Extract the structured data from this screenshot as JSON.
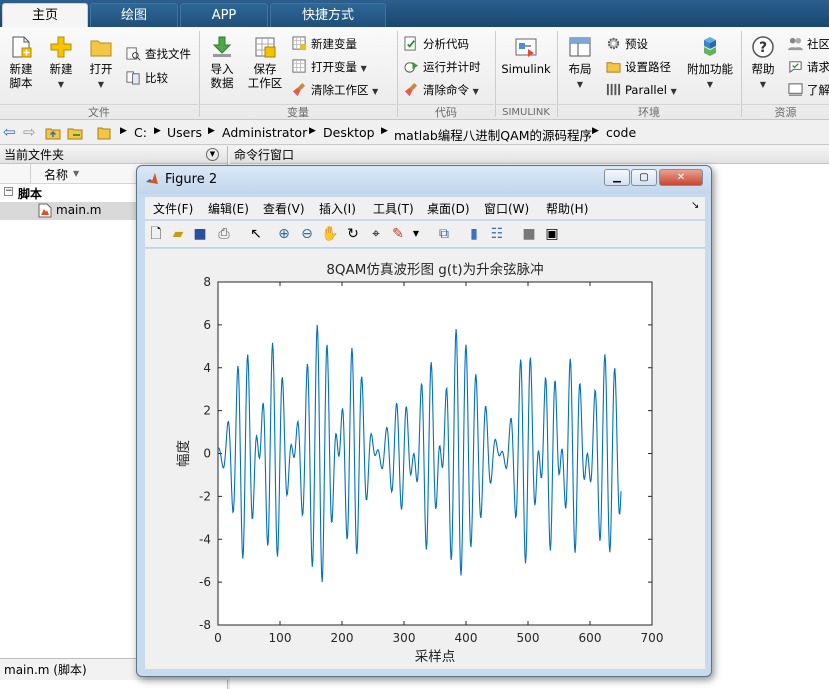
{
  "tabs": [
    "主页",
    "绘图",
    "APP",
    "快捷方式"
  ],
  "ribbon": {
    "file": {
      "new_script": "新建\n脚本",
      "new": "新建",
      "open": "打开",
      "find_files": "查找文件",
      "compare": "比较",
      "group": "文件"
    },
    "variable": {
      "import_data": "导入\n数据",
      "save_workspace": "保存\n工作区",
      "new_variable": "新建变量",
      "open_variable": "打开变量",
      "clear_workspace": "清除工作区",
      "group": "变量"
    },
    "code": {
      "analyze_code": "分析代码",
      "run_and_time": "运行并计时",
      "clear_commands": "清除命令",
      "group": "代码"
    },
    "simulink": {
      "simulink": "Simulink",
      "group": "SIMULINK"
    },
    "environment": {
      "layout": "布局",
      "preferences": "预设",
      "set_path": "设置路径",
      "parallel": "Parallel",
      "addons": "附加功能",
      "group": "环境"
    },
    "resources": {
      "help": "帮助",
      "community": "社区",
      "request_support": "请求",
      "learn": "了解",
      "group": "资源"
    }
  },
  "address": {
    "segments": [
      "C:",
      "Users",
      "Administrator",
      "Desktop",
      "matlab编程八进制QAM的源码程序",
      "code"
    ]
  },
  "left_panel": {
    "title": "当前文件夹",
    "col_name": "名称",
    "folder": "脚本",
    "file": "main.m",
    "status": "main.m  (脚本)"
  },
  "cmd_panel": {
    "title": "命令行窗口"
  },
  "figure": {
    "title": "Figure 2",
    "menu": [
      "文件(F)",
      "编辑(E)",
      "查看(V)",
      "插入(I)",
      "工具(T)",
      "桌面(D)",
      "窗口(W)",
      "帮助(H)"
    ]
  },
  "chart_data": {
    "type": "line",
    "title": "8QAM仿真波形图  g(t)为升余弦脉冲",
    "xlabel": "采样点",
    "ylabel": "幅度",
    "xlim": [
      0,
      700
    ],
    "ylim": [
      -8,
      8
    ],
    "xticks": [
      0,
      100,
      200,
      300,
      400,
      500,
      600,
      700
    ],
    "yticks": [
      -8,
      -6,
      -4,
      -2,
      0,
      2,
      4,
      6,
      8
    ],
    "grid": false,
    "series": [
      {
        "color": "#0072bd",
        "symbols": [
          1,
          3,
          -3,
          -1,
          3,
          3,
          -3,
          -1,
          1,
          1,
          -3,
          3,
          3,
          1,
          -1,
          -3,
          3,
          -3,
          1,
          3
        ],
        "samples": 650
      }
    ]
  },
  "colors": {
    "line": "#0072bd",
    "tabbar": "#1f4e79"
  }
}
